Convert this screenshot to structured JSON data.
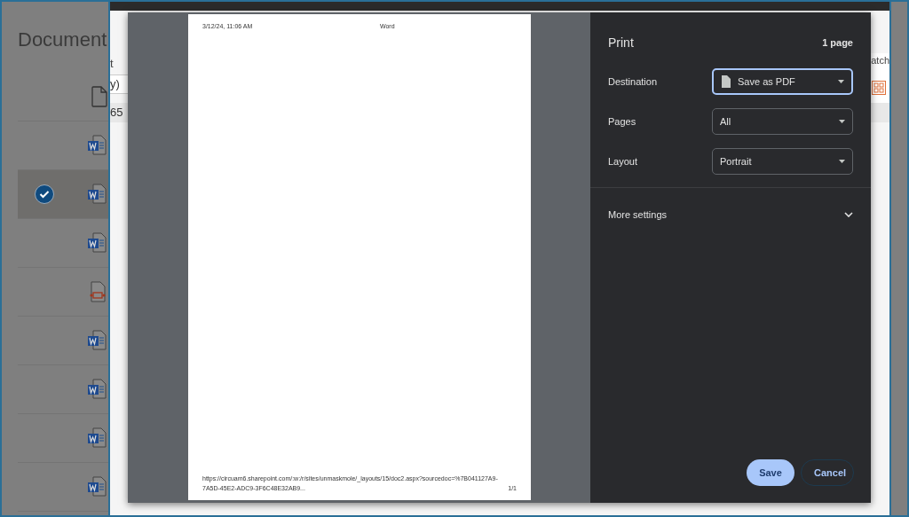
{
  "background": {
    "title": "Document",
    "fragments": [
      {
        "kind": "label",
        "text": "t"
      },
      {
        "kind": "field",
        "text": "y)"
      },
      {
        "kind": "band",
        "text": "65"
      },
      {
        "kind": "right",
        "text": "atch"
      }
    ],
    "files": [
      {
        "kind": "blank",
        "selected": false
      },
      {
        "kind": "word",
        "selected": false
      },
      {
        "kind": "word",
        "selected": true
      },
      {
        "kind": "word",
        "selected": false
      },
      {
        "kind": "pdf",
        "selected": false
      },
      {
        "kind": "word",
        "selected": false
      },
      {
        "kind": "word",
        "selected": false
      },
      {
        "kind": "word",
        "selected": false
      },
      {
        "kind": "word",
        "selected": false
      }
    ]
  },
  "preview": {
    "header_left": "3/12/24, 11:06 AM",
    "header_center": "Word",
    "footer_url": "https://circuam6.sharepoint.com/:w:/r/sites/unmaskmole/_layouts/15/doc2.aspx?sourcedoc=%7B041127A9-7A5D-45E2-ADC9-3F6C48E32AB9...",
    "footer_page": "1/1"
  },
  "print": {
    "title": "Print",
    "page_count": "1 page",
    "settings": [
      {
        "label": "Destination",
        "value": "Save as PDF",
        "focused": true,
        "kind": "pdf"
      },
      {
        "label": "Pages",
        "value": "All",
        "focused": false,
        "kind": "plain"
      },
      {
        "label": "Layout",
        "value": "Portrait",
        "focused": false,
        "kind": "plain"
      }
    ],
    "more_settings": {
      "label": "More settings",
      "expanded": false
    },
    "buttons": [
      {
        "label": "Save",
        "kind": "primary"
      },
      {
        "label": "Cancel",
        "kind": "secondary"
      }
    ]
  }
}
